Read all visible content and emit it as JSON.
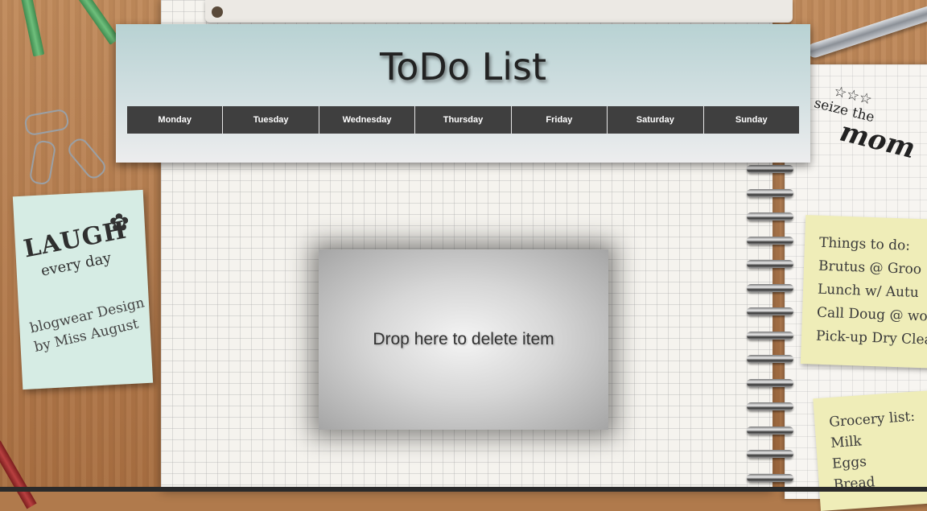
{
  "app": {
    "title": "ToDo List"
  },
  "days": [
    "Monday",
    "Tuesday",
    "Wednesday",
    "Thursday",
    "Friday",
    "Saturday",
    "Sunday"
  ],
  "dropzone": {
    "label": "Drop here to delete item"
  },
  "decor": {
    "left_note": {
      "line1": "LAUGH",
      "line2": "every day",
      "credit": "blogwear Design by Miss August"
    },
    "todo_note": {
      "lines": [
        "Things to do:",
        "Brutus @ Groo",
        "Lunch w/ Autu",
        "Call Doug @ wor",
        "Pick-up Dry Clea"
      ]
    },
    "grocery_note": {
      "lines": [
        "Grocery list:",
        "Milk",
        "Eggs",
        "Bread"
      ]
    },
    "stamp": {
      "line1": "seize the",
      "line2": "mom"
    }
  },
  "colors": {
    "day_bar": "#3f3f3f",
    "header_top": "#b8d2d3",
    "header_bottom": "#ededee"
  }
}
